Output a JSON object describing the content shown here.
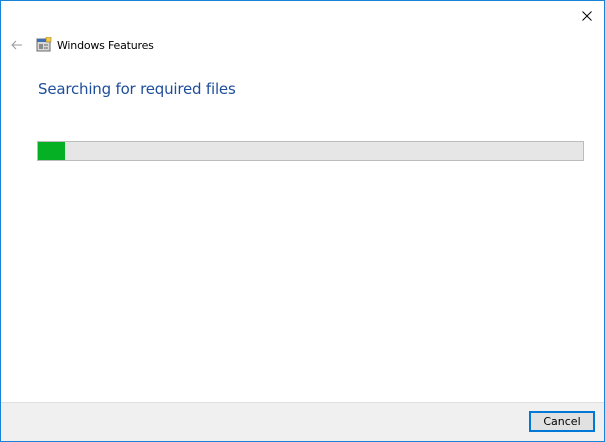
{
  "window": {
    "title": "Windows Features",
    "accent_color": "#1883d7"
  },
  "titlebar": {
    "close_icon": "close-icon"
  },
  "nav": {
    "back_icon": "back-arrow-icon",
    "app_icon": "windows-features-icon"
  },
  "main": {
    "heading": "Searching for required files",
    "heading_color": "#1e4e9b",
    "progress": {
      "value": 0.05,
      "fill_color": "#06b025",
      "track_color": "#e6e6e6"
    }
  },
  "footer": {
    "cancel_label": "Cancel"
  }
}
